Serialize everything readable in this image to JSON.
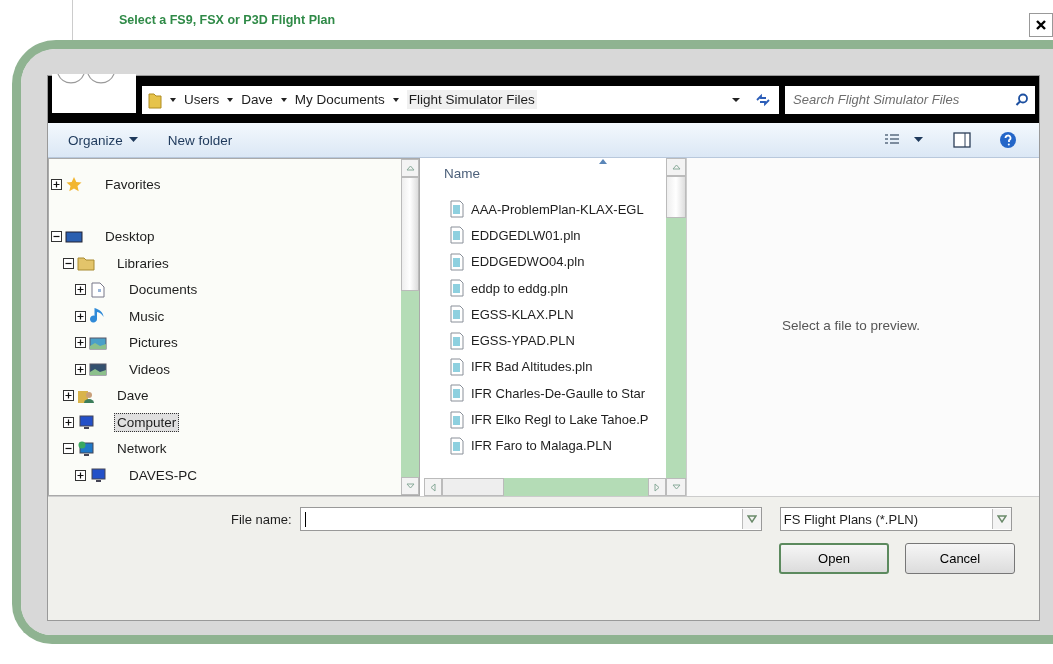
{
  "window": {
    "title": "Select a FS9, FSX or P3D Flight Plan"
  },
  "address_bar": {
    "breadcrumbs": [
      "Users",
      "Dave",
      "My Documents",
      "Flight Simulator Files"
    ],
    "search": {
      "placeholder": "Search Flight Simulator Files"
    }
  },
  "toolbar": {
    "organize": "Organize",
    "new_folder": "New folder"
  },
  "tree": [
    {
      "label": "Favorites",
      "kind": "favorites",
      "expanded": false,
      "selected": false
    },
    {
      "label": "Desktop",
      "kind": "desktop",
      "expanded": true,
      "selected": false,
      "children": [
        {
          "label": "Libraries",
          "kind": "library",
          "expanded": true,
          "selected": false,
          "children": [
            {
              "label": "Documents",
              "kind": "documents",
              "expanded": false,
              "selected": false
            },
            {
              "label": "Music",
              "kind": "music",
              "expanded": false,
              "selected": false
            },
            {
              "label": "Pictures",
              "kind": "pictures",
              "expanded": false,
              "selected": false
            },
            {
              "label": "Videos",
              "kind": "videos",
              "expanded": false,
              "selected": false
            }
          ]
        },
        {
          "label": "Dave",
          "kind": "user",
          "expanded": false,
          "selected": false
        },
        {
          "label": "Computer",
          "kind": "computer",
          "expanded": false,
          "selected": true
        },
        {
          "label": "Network",
          "kind": "network",
          "expanded": true,
          "selected": false,
          "children": [
            {
              "label": "DAVES-PC",
              "kind": "computer",
              "expanded": false,
              "selected": false
            }
          ]
        }
      ]
    }
  ],
  "file_list": {
    "column": "Name",
    "files": [
      "AAA-ProblemPlan-KLAX-EGL",
      "EDDGEDLW01.pln",
      "EDDGEDWO04.pln",
      "eddp to eddg.pln",
      "EGSS-KLAX.PLN",
      "EGSS-YPAD.PLN",
      "IFR Bad Altitudes.pln",
      "IFR Charles-De-Gaulle to Star",
      "IFR Elko Regl to Lake Tahoe.P",
      "IFR Faro to Malaga.PLN"
    ]
  },
  "preview": {
    "message": "Select a file to preview."
  },
  "footer": {
    "file_name_label": "File name:",
    "file_type": "FS Flight Plans (*.PLN)",
    "buttons": [
      "Open",
      "Cancel"
    ]
  }
}
